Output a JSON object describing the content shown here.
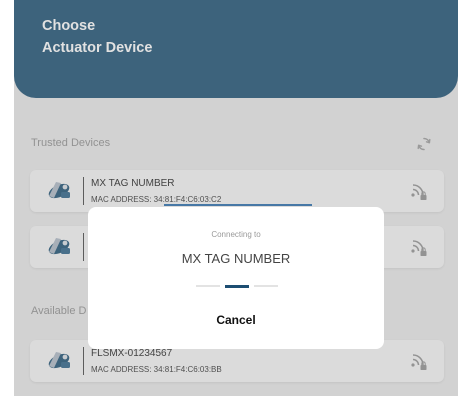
{
  "header": {
    "line1": "Choose",
    "line2": "Actuator Device"
  },
  "trusted": {
    "label": "Trusted Devices",
    "devices": [
      {
        "name": "MX TAG NUMBER",
        "mac": "MAC ADDRESS: 34:81:F4:C6:03:C2"
      },
      {
        "name": "",
        "mac": ""
      }
    ]
  },
  "available": {
    "label_visible": "Available D",
    "devices": [
      {
        "name": "FLSMX-01234567",
        "mac": "MAC ADDRESS: 34:81:F4:C6:03:BB"
      }
    ]
  },
  "dialog": {
    "status": "Connecting to",
    "device_name": "MX TAG NUMBER",
    "cancel_label": "Cancel"
  },
  "colors": {
    "header_bg": "#2e5e7e",
    "progress": "#3a79b4",
    "loader_active": "#1d4e72"
  },
  "icons": {
    "refresh": "refresh-icon",
    "device": "actuator-device-icon",
    "secure_signal": "wifi-lock-icon"
  }
}
